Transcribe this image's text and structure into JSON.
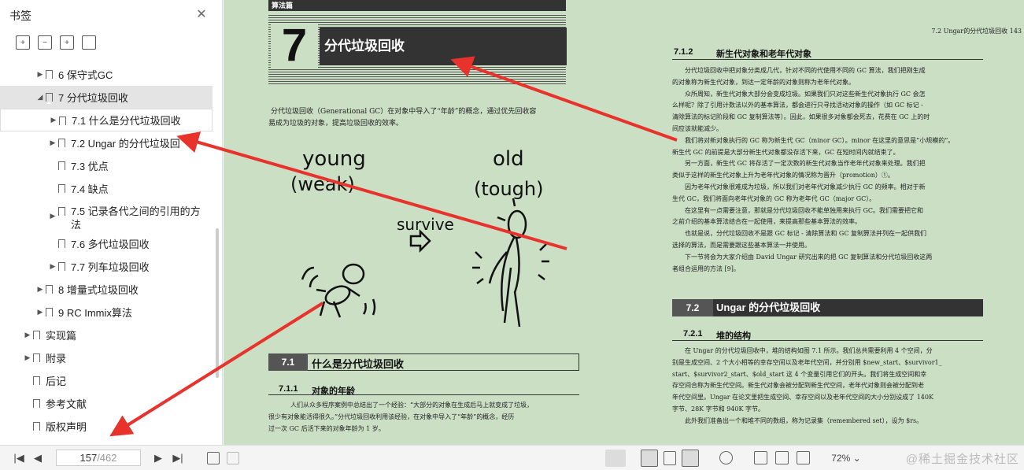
{
  "sidebar": {
    "title": "书签",
    "close_icon": "close-icon",
    "tools": [
      "expand-all-icon",
      "collapse-all-icon",
      "add-bookmark-icon",
      "bookmark-icon"
    ],
    "items": [
      {
        "label": "6  保守式GC",
        "level": 1,
        "arrow": "▶"
      },
      {
        "label": "7  分代垃圾回收",
        "level": 1,
        "arrow": "◢",
        "selected": true
      },
      {
        "label": "7.1  什么是分代垃圾回收",
        "level": 2,
        "arrow": "▶",
        "hover": true
      },
      {
        "label": "7.2  Ungar 的分代垃圾回",
        "level": 2,
        "arrow": "▶"
      },
      {
        "label": "7.3  优点",
        "level": 2,
        "arrow": ""
      },
      {
        "label": "7.4  缺点",
        "level": 2,
        "arrow": ""
      },
      {
        "label": "7.5  记录各代之间的引用的方",
        "label2": "法",
        "level": 2,
        "arrow": "▶"
      },
      {
        "label": "7.6  多代垃圾回收",
        "level": 2,
        "arrow": ""
      },
      {
        "label": "7.7  列车垃圾回收",
        "level": 2,
        "arrow": "▶"
      },
      {
        "label": "8  增量式垃圾回收",
        "level": 1,
        "arrow": "▶"
      },
      {
        "label": "9  RC Immix算法",
        "level": 1,
        "arrow": "▶"
      },
      {
        "label": "实现篇",
        "level": 0,
        "arrow": "▶"
      },
      {
        "label": "附录",
        "level": 0,
        "arrow": "▶"
      },
      {
        "label": "后记",
        "level": 0,
        "arrow": ""
      },
      {
        "label": "参考文献",
        "level": 0,
        "arrow": ""
      },
      {
        "label": "版权声明",
        "level": 0,
        "arrow": ""
      }
    ]
  },
  "left_page": {
    "part_label": "算法篇",
    "chapter_num": "7",
    "chapter_title": "分代垃圾回收",
    "intro_1": "分代垃圾回收（Generational GC）在对象中导入了“年龄”的概念，通过优先回收容",
    "intro_2": "易成为垃圾的对象，提高垃圾回收的效率。",
    "drawing": {
      "young": "young",
      "weak": "(weak)",
      "old": "old",
      "tough": "(tough)",
      "survive": "survive"
    },
    "sec_num": "7.1",
    "sec_title": "什么是分代垃圾回收",
    "sub_num": "7.1.1",
    "sub_title": "对象的年龄",
    "p1": "人们从众多程序案例中总结出了一个经验：“大部分的对象在生成后马上就变成了垃圾，",
    "p2": "很少有对象能活得很久。”分代垃圾回收利用该经验，在对象中导入了“年龄”的概念，经历",
    "p3": "过一次 GC 后活下来的对象年龄为 1 岁。"
  },
  "right_page": {
    "running_head": "7.2   Ungar的分代垃圾回收    143",
    "sub1_num": "7.1.2",
    "sub1_title": "新生代对象和老年代对象",
    "lines": [
      "分代垃圾回收中把对象分类成几代，针对不同的代使用不同的 GC 算法，我们把刚生成",
      "的对象称为新生代对象，到达一定年龄的对象则称为老年代对象。",
      "众所周知，新生代对象大部分会变成垃圾。如果我们只对这些新生代对象执行 GC 会怎",
      "么样呢？除了引用计数法以外的基本算法，都会进行只寻找活动对象的操作（如 GC 标记 -",
      "清除算法的标记阶段和 GC 复制算法等）。因此，如果很多对象都会死去，花费在 GC 上的时",
      "间应该就能减少。",
      "我们将对新对象执行的 GC 称为新生代 GC（minor GC）。minor 在这里的意思是“小规模的”。",
      "新生代 GC 的前提是大部分新生代对象都没存活下来，GC 在短时间内就结束了。",
      "另一方面，新生代 GC 将存活了一定次数的新生代对象当作老年代对象来处理。我们把",
      "类似于这样的新生代对象上升为老年代对象的情况称为晋升（promotion）①。",
      "因为老年代对象很难成为垃圾，所以我们对老年代对象减少执行 GC 的频率。相对于新",
      "生代 GC，我们将面向老年代对象的 GC 称为老年代 GC（major GC）。",
      "在这里有一点需要注意，那就是分代垃圾回收不能单独用来执行 GC。我们需要把它和",
      "之前介绍的基本算法结合在一起使用，来提高那些基本算法的效率。",
      "也就是说，分代垃圾回收不是跟 GC 标记 - 清除算法和 GC 复制算法并列在一起供我们",
      "选择的算法，而是需要跟这些基本算法一并使用。",
      "下一节将会为大家介绍由 David Ungar 研究出来的把 GC 复制算法和分代垃圾回收这两",
      "者组合运用的方法 [9]。"
    ],
    "sec_num": "7.2",
    "sec_title": "Ungar 的分代垃圾回收",
    "sub2_num": "7.2.1",
    "sub2_title": "堆的结构",
    "lines2": [
      "在 Ungar 的分代垃圾回收中，堆的结构如图 7.1 所示。我们总共需要利用 4 个空间，分",
      "别是生成空间、2 个大小相等的幸存空间以及老年代空间，并分别用 $new_start、$survivor1_",
      "start、$survivor2_start、$old_start 这 4 个变量引用它们的开头。我们将生成空间和幸",
      "存空间合称为新生代空间。新生代对象会被分配到新生代空间，老年代对象则会被分配到老",
      "年代空间里。Ungar 在论文里把生成空间、幸存空间以及老年代空间的大小分别设成了 140K",
      "字节、28K 字节和 940K 字节。",
      "此外我们准备出一个和堆不同的数组，称为记录集（remembered set），设为 $rs。"
    ]
  },
  "toolbar": {
    "first": "|◀",
    "prev": "◀",
    "current_page": "157",
    "total_pages": "/462",
    "next": "▶",
    "last": "▶|",
    "zoom": "72%",
    "watermark": "@稀土掘金技术社区"
  },
  "colors": {
    "page_bg": "#cbdfc5",
    "arrow": "#e8322c",
    "header_dark": "#333333"
  }
}
